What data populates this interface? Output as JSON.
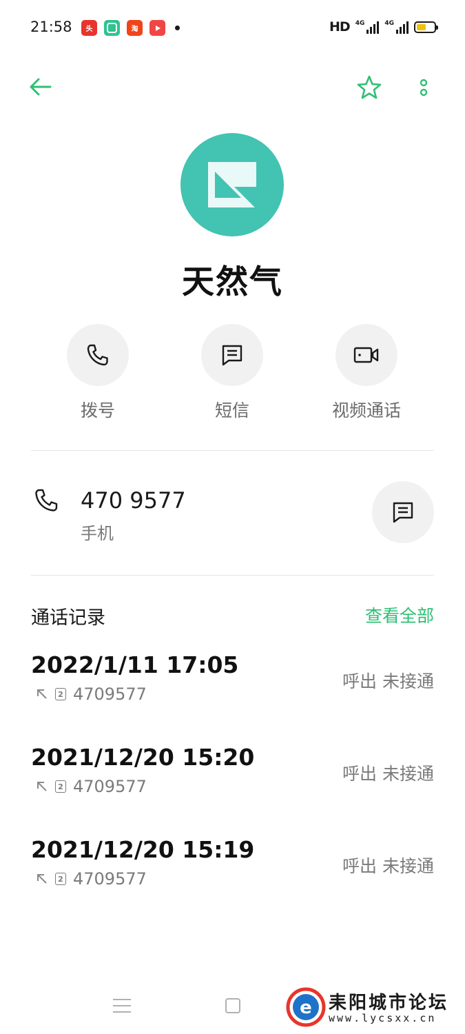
{
  "status_bar": {
    "time": "21:58",
    "hd": "HD",
    "network_1": "4G",
    "network_2": "4G",
    "notification_icons": [
      "toutiao-icon",
      "app-green-icon",
      "taobao-icon",
      "video-icon"
    ],
    "battery_level": 0.55
  },
  "header": {
    "back_icon": "arrow-left-icon",
    "star_icon": "star-outline-icon",
    "more_icon": "more-vertical-icon"
  },
  "contact": {
    "name": "天然气",
    "avatar_color": "#43c3b1"
  },
  "actions": [
    {
      "label": "拨号",
      "icon": "phone-icon"
    },
    {
      "label": "短信",
      "icon": "message-icon"
    },
    {
      "label": "视频通话",
      "icon": "video-call-icon"
    }
  ],
  "phone": {
    "number": "470 9577",
    "type": "手机"
  },
  "call_log": {
    "title": "通话记录",
    "view_all": "查看全部",
    "items": [
      {
        "datetime": "2022/1/11 17:05",
        "sim": "2",
        "number": "4709577",
        "status": "呼出 未接通"
      },
      {
        "datetime": "2021/12/20 15:20",
        "sim": "2",
        "number": "4709577",
        "status": "呼出 未接通"
      },
      {
        "datetime": "2021/12/20 15:19",
        "sim": "2",
        "number": "4709577",
        "status": "呼出 未接通"
      }
    ]
  },
  "watermark": {
    "title": "耒阳城市论坛",
    "url": "www.lycsxx.cn"
  },
  "colors": {
    "accent": "#2fbf74",
    "avatar": "#43c3b1"
  }
}
